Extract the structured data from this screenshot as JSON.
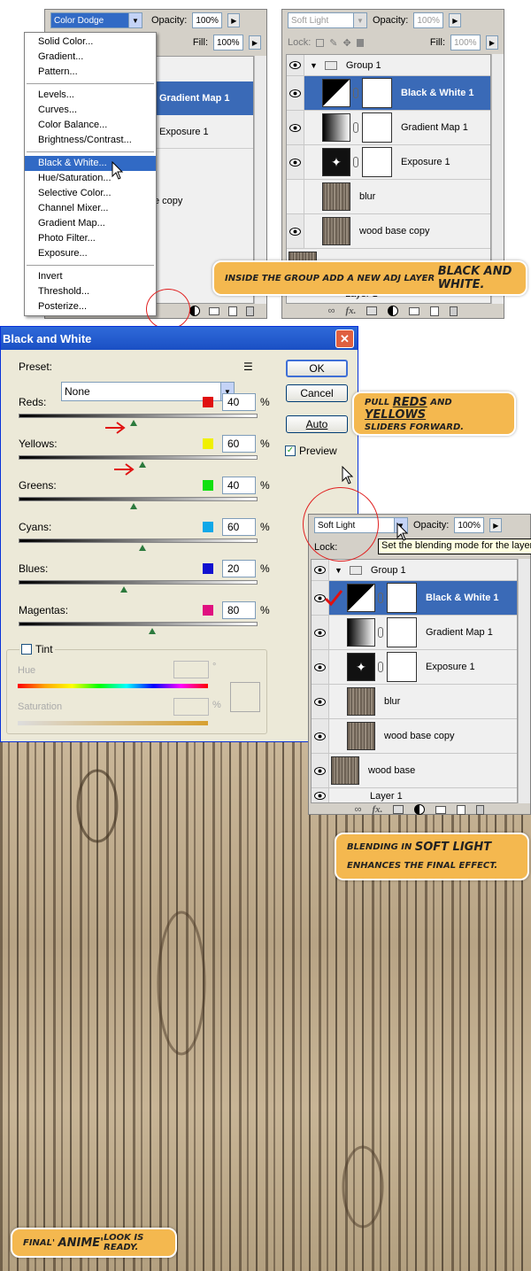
{
  "colors": {
    "accent": "#3a6ab7",
    "callout": "#f4b84f",
    "circle": "#e02020"
  },
  "panel1": {
    "blend_mode": "Color Dodge",
    "opacity_label": "Opacity:",
    "opacity_value": "100%",
    "fill_label": "Fill:",
    "fill_value": "100%",
    "layers": [
      {
        "name": "Gradient Map 1",
        "selected": true
      },
      {
        "name": "Exposure 1"
      },
      {
        "name": "e copy"
      }
    ]
  },
  "adj_menu": {
    "items": [
      "Solid Color...",
      "Gradient...",
      "Pattern...",
      "Levels...",
      "Curves...",
      "Color Balance...",
      "Brightness/Contrast...",
      "Black & White...",
      "Hue/Saturation...",
      "Selective Color...",
      "Channel Mixer...",
      "Gradient Map...",
      "Photo Filter...",
      "Exposure...",
      "Invert",
      "Threshold...",
      "Posterize..."
    ],
    "highlighted": "Black & White..."
  },
  "panel2": {
    "blend_mode": "Soft Light",
    "opacity_label": "Opacity:",
    "opacity_value": "100%",
    "lock_label": "Lock:",
    "fill_label": "Fill:",
    "fill_value": "100%",
    "layers": [
      {
        "name": "Group 1",
        "type": "group"
      },
      {
        "name": "Black & White 1",
        "selected": true
      },
      {
        "name": "Gradient Map 1"
      },
      {
        "name": "Exposure 1"
      },
      {
        "name": "blur"
      },
      {
        "name": "wood base copy"
      },
      {
        "name": "Layer 1"
      }
    ]
  },
  "callout1": {
    "pre": "Inside the group add a new adj layer ",
    "emph": "Black and White."
  },
  "bw_dialog": {
    "title": "Black and White",
    "preset_label": "Preset:",
    "preset_value": "None",
    "ok": "OK",
    "cancel": "Cancel",
    "auto": "Auto",
    "preview": "Preview",
    "sliders": [
      {
        "label": "Reds:",
        "value": "40",
        "pct": 40,
        "color": "#e01010"
      },
      {
        "label": "Yellows:",
        "value": "60",
        "pct": 60,
        "color": "#f0f000"
      },
      {
        "label": "Greens:",
        "value": "40",
        "pct": 40,
        "color": "#10e010"
      },
      {
        "label": "Cyans:",
        "value": "60",
        "pct": 60,
        "color": "#10a8e8"
      },
      {
        "label": "Blues:",
        "value": "20",
        "pct": 20,
        "color": "#1010d0"
      },
      {
        "label": "Magentas:",
        "value": "80",
        "pct": 80,
        "color": "#e01080"
      }
    ],
    "tint": "Tint",
    "hue": "Hue",
    "saturation": "Saturation",
    "unit": "%",
    "degree": "°"
  },
  "callout2": {
    "pre": "Pull ",
    "reds": "Reds",
    "and": " and ",
    "yellows": "Yellows",
    "post": " sliders forward."
  },
  "panel3": {
    "blend_mode": "Soft Light",
    "opacity_label": "Opacity:",
    "opacity_value": "100%",
    "lock_label": "Lock:",
    "tooltip": "Set the blending mode for the layer",
    "layers": [
      {
        "name": "Group 1",
        "type": "group"
      },
      {
        "name": "Black & White 1",
        "selected": true
      },
      {
        "name": "Gradient Map 1"
      },
      {
        "name": "Exposure 1"
      },
      {
        "name": "blur"
      },
      {
        "name": "wood base copy"
      },
      {
        "name": "wood base"
      },
      {
        "name": "Layer 1"
      }
    ]
  },
  "callout3": {
    "pre": "Blending in ",
    "emph": "Soft Light",
    "post": " enhances the final effect."
  },
  "callout4": {
    "pre": "Final' ",
    "emph": "Anime'",
    "post": " look is ready."
  }
}
